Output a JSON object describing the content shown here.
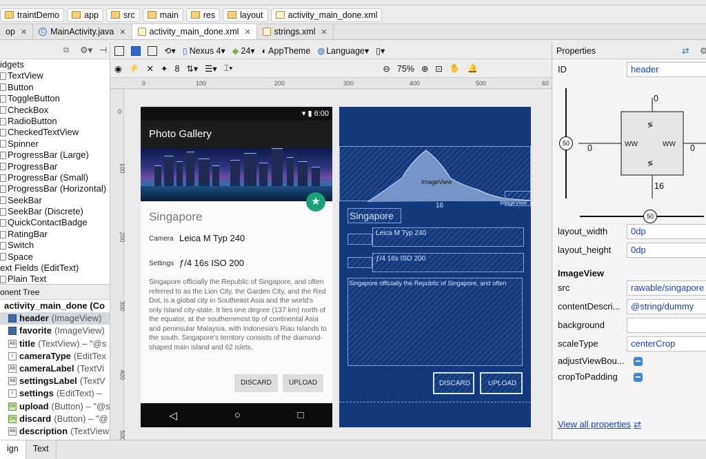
{
  "breadcrumbs": [
    "traintDemo",
    "app",
    "src",
    "main",
    "res",
    "layout",
    "activity_main_done.xml"
  ],
  "editor_tabs": [
    {
      "label": "op",
      "active": false
    },
    {
      "label": "MainActivity.java",
      "active": false
    },
    {
      "label": "activity_main_done.xml",
      "active": true
    },
    {
      "label": "strings.xml",
      "active": false
    }
  ],
  "palette": {
    "categories": [
      {
        "label": "idgets",
        "items": [
          "TextView",
          "Button",
          "ToggleButton",
          "CheckBox",
          "RadioButton",
          "CheckedTextView",
          "Spinner",
          "ProgressBar (Large)",
          "ProgressBar",
          "ProgressBar (Small)",
          "ProgressBar (Horizontal)",
          "SeekBar",
          "SeekBar (Discrete)",
          "QuickContactBadge",
          "RatingBar",
          "Switch",
          "Space"
        ]
      },
      {
        "label": "ext Fields (EditText)",
        "items": [
          "Plain Text"
        ]
      }
    ]
  },
  "tree": {
    "header": "onent Tree",
    "root": "activity_main_done (Co",
    "items": [
      {
        "name": "header",
        "type": "(ImageView)",
        "icon": "image",
        "selected": true
      },
      {
        "name": "favorite",
        "type": "(ImageView)",
        "icon": "image",
        "selected": false
      },
      {
        "name": "title",
        "type": "(TextView) – \"@s",
        "icon": "text",
        "selected": false
      },
      {
        "name": "cameraType",
        "type": "(EditTex",
        "icon": "edit",
        "selected": false
      },
      {
        "name": "cameraLabel",
        "type": "(TextVi",
        "icon": "text",
        "selected": false
      },
      {
        "name": "settingsLabel",
        "type": "(TextV",
        "icon": "text",
        "selected": false
      },
      {
        "name": "settings",
        "type": "(EditText) –",
        "icon": "edit",
        "selected": false
      },
      {
        "name": "upload",
        "type": "(Button) – \"@s",
        "icon": "button",
        "selected": false
      },
      {
        "name": "discard",
        "type": "(Button) – \"@",
        "icon": "button",
        "selected": false
      },
      {
        "name": "description",
        "type": "(TextView",
        "icon": "text",
        "selected": false
      }
    ]
  },
  "toolbar1": {
    "device": "Nexus 4",
    "api": "24",
    "theme": "AppTheme",
    "language": "Language"
  },
  "toolbar2": {
    "margin": "8",
    "zoom": "75%"
  },
  "ruler_top": [
    "0",
    "100",
    "200",
    "300",
    "400",
    "500",
    "60"
  ],
  "ruler_left": [
    "0",
    "100",
    "200",
    "300",
    "400",
    "500"
  ],
  "phone": {
    "time": "6:00",
    "app_title": "Photo Gallery",
    "place_title": "Singapore",
    "camera_label": "Camera",
    "camera_value": "Leica M Typ 240",
    "settings_label": "Settings",
    "settings_value": "ƒ/4 16s ISO 200",
    "description": "Singapore officially the Republic of Singapore, and often referred to as the Lion City, the Garden City, and the Red Dot, is a global city in Southeast Asia and the world's only island city-state. It lies one degree (137 km) north of the equator, at the southernmost tip of continental Asia and peninsular Malaysia, with Indonesia's Riau Islands to the south. Singapore's territory consists of the diamond-shaped main island and 62 islets.",
    "discard": "DISCARD",
    "upload": "UPLOAD"
  },
  "blueprint": {
    "imageview": "ImageView",
    "imageview_small": "ImageView",
    "margin": "16",
    "title": "Singapore",
    "camera_value": "Leica M Typ 240",
    "settings_value": "ƒ/4 16s ISO 200",
    "description": "Singapore officially the Republic of Singapore, and often",
    "discard": "DISCARD",
    "upload": "UPLOAD"
  },
  "properties": {
    "title": "Properties",
    "id_label": "ID",
    "id_value": "header",
    "margins": {
      "top": "0",
      "left": "0",
      "right": "0",
      "bottom": "16",
      "bias_v": "50",
      "bias_h": "50"
    },
    "layout_width_label": "layout_width",
    "layout_width": "0dp",
    "layout_height_label": "layout_height",
    "layout_height": "0dp",
    "section": "ImageView",
    "src_label": "src",
    "src": "rawable/singapore",
    "content_desc_label": "contentDescri...",
    "content_desc": "@string/dummy",
    "background_label": "background",
    "background": "",
    "scaletype_label": "scaleType",
    "scaletype": "centerCrop",
    "adjust_label": "adjustViewBou...",
    "crop_label": "cropToPadding",
    "view_all": "View all properties"
  },
  "bottom_tabs": [
    {
      "label": "ign",
      "active": true
    },
    {
      "label": "Text",
      "active": false
    }
  ],
  "colors": {
    "accent": "#1aa37a",
    "blueprint": "#12397c",
    "link": "#1a3fc2"
  }
}
